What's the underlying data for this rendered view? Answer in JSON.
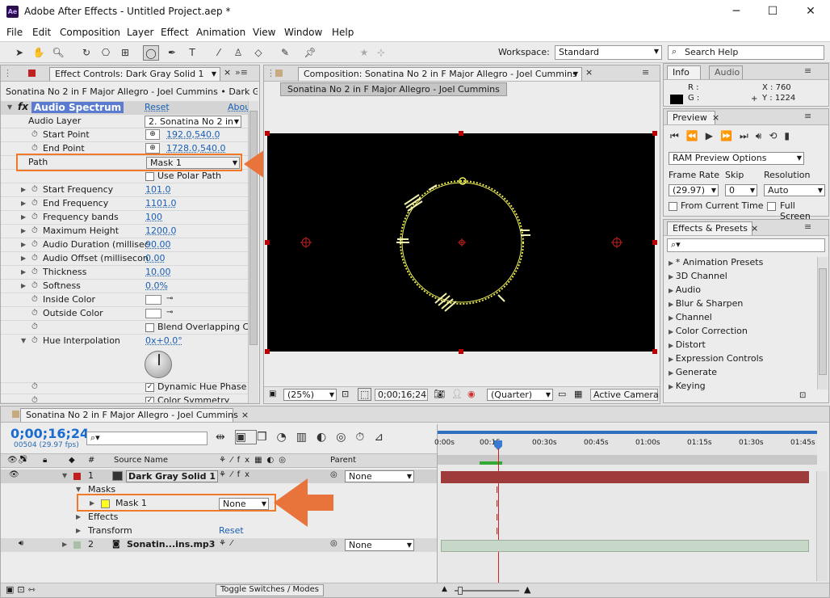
{
  "window": {
    "app_icon": "Ae",
    "title": "Adobe After Effects - Untitled Project.aep *",
    "min": "─",
    "max": "☐",
    "close": "✕"
  },
  "menu": [
    "File",
    "Edit",
    "Composition",
    "Layer",
    "Effect",
    "Animation",
    "View",
    "Window",
    "Help"
  ],
  "toolbar": {
    "workspace_label": "Workspace:",
    "workspace_value": "Standard",
    "search_placeholder": "Search Help"
  },
  "effect_controls": {
    "tab": "Effect Controls: Dark Gray Solid 1",
    "breadcrumb": "Sonatina No 2 in F Major Allegro - Joel Cummins • Dark Gray",
    "effect_name": "Audio Spectrum",
    "reset": "Reset",
    "about": "Abou",
    "rows": [
      {
        "label": "Audio Layer",
        "value": "2. Sonatina No 2 in"
      },
      {
        "label": "Start Point",
        "value": "192.0,540.0"
      },
      {
        "label": "End Point",
        "value": "1728.0,540.0"
      },
      {
        "label": "Path",
        "value": "Mask 1"
      },
      {
        "label": "Use Polar Path",
        "value": ""
      },
      {
        "label": "Start Frequency",
        "value": "101.0"
      },
      {
        "label": "End Frequency",
        "value": "1101.0"
      },
      {
        "label": "Frequency bands",
        "value": "100"
      },
      {
        "label": "Maximum Height",
        "value": "1200.0"
      },
      {
        "label": "Audio Duration (millisec",
        "value": "90.00"
      },
      {
        "label": "Audio Offset (millisecon",
        "value": "0.00"
      },
      {
        "label": "Thickness",
        "value": "10.00"
      },
      {
        "label": "Softness",
        "value": "0.0%"
      },
      {
        "label": "Inside Color",
        "value": ""
      },
      {
        "label": "Outside Color",
        "value": ""
      },
      {
        "label": "Blend Overlapping C",
        "value": ""
      },
      {
        "label": "Hue Interpolation",
        "value": "0x+0.0°"
      },
      {
        "label": "Dynamic Hue Phase",
        "value": ""
      },
      {
        "label": "Color Symmetry",
        "value": ""
      }
    ]
  },
  "composition": {
    "tab": "Composition: Sonatina No 2 in F Major Allegro - Joel Cummins",
    "subtab": "Sonatina No 2 in F Major Allegro - Joel Cummins",
    "zoom": "(25%)",
    "timecode": "0;00;16;24",
    "resolution": "(Quarter)",
    "camera": "Active Camera"
  },
  "info": {
    "tab_info": "Info",
    "tab_audio": "Audio",
    "r": "R :",
    "g": "G :",
    "x": "X : 760",
    "y": "Y : 1224"
  },
  "preview": {
    "tab": "Preview",
    "ram_options": "RAM Preview Options",
    "frame_rate_label": "Frame Rate",
    "skip_label": "Skip",
    "resolution_label": "Resolution",
    "frame_rate": "(29.97)",
    "skip": "0",
    "resolution": "Auto",
    "from_current": "From Current Time",
    "full_screen": "Full Screen"
  },
  "effects_presets": {
    "tab": "Effects & Presets",
    "items": [
      "* Animation Presets",
      "3D Channel",
      "Audio",
      "Blur & Sharpen",
      "Channel",
      "Color Correction",
      "Distort",
      "Expression Controls",
      "Generate",
      "Keying"
    ]
  },
  "timeline": {
    "tab": "Sonatina No 2 in F Major Allegro - Joel Cummins",
    "timecode": "0;00;16;24",
    "fps": "00504 (29.97 fps)",
    "col_num": "#",
    "col_source": "Source Name",
    "col_parent": "Parent",
    "layer1_num": "1",
    "layer1_name": "Dark Gray Solid 1",
    "layer1_parent": "None",
    "masks": "Masks",
    "mask1": "Mask 1",
    "mask1_mode": "None",
    "effects": "Effects",
    "transform": "Transform",
    "transform_reset": "Reset",
    "layer2_num": "2",
    "layer2_name": "Sonatin...ins.mp3",
    "layer2_parent": "None",
    "toggle": "Toggle Switches / Modes",
    "ruler": [
      "0:00s",
      "00:15",
      "00:30s",
      "00:45s",
      "01:00s",
      "01:15s",
      "01:30s",
      "01:45s"
    ]
  }
}
